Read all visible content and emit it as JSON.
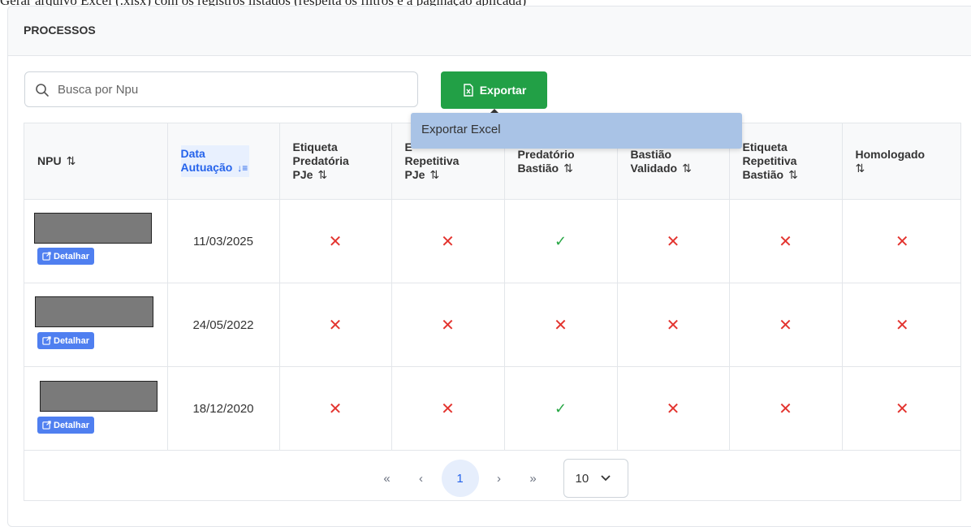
{
  "top_text": "Gerar arquivo Excel (.xlsx) com os registros listados (respeita os filtros e a paginação aplicada)",
  "panel": {
    "title": "PROCESSOS"
  },
  "search": {
    "placeholder": "Busca por Npu",
    "value": ""
  },
  "export": {
    "label": "Exportar",
    "menu": {
      "item_excel": "Exportar Excel"
    }
  },
  "table": {
    "columns": [
      {
        "label": "NPU",
        "sort": "⇅"
      },
      {
        "label": "Data Autuação",
        "sort": "↓≡",
        "sorted": true
      },
      {
        "label": "Etiqueta Predatória PJe",
        "sort": "⇅"
      },
      {
        "label": "Etiqueta Repetitiva PJe",
        "sort": "⇅"
      },
      {
        "label": "Predatório Bastião",
        "sort": "⇅"
      },
      {
        "label": "Bastião Validado",
        "sort": "⇅"
      },
      {
        "label": "Etiqueta Repetitiva Bastião",
        "sort": "⇅"
      },
      {
        "label": "Homologado",
        "sort": "⇅"
      }
    ],
    "header_visible": {
      "npu": "NPU",
      "data_1": "Data",
      "data_2": "Autuação",
      "etiq_pred_1": "Etiqueta",
      "etiq_pred_2": "Predatória",
      "etiq_pred_3": "PJe",
      "etiq_rep_1": "E",
      "etiq_rep_2": "Repetitiva",
      "etiq_rep_3": "PJe",
      "pred_bastiao_1": "Predatório",
      "pred_bastiao_2": "Bastião",
      "bast_val_1": "Bastião",
      "bast_val_2": "Validado",
      "etiq_rep_bast_1": "Etiqueta",
      "etiq_rep_bast_2": "Repetitiva",
      "etiq_rep_bast_3": "Bastião",
      "homologado": "Homologado"
    },
    "detail_label": "Detalhar",
    "rows": [
      {
        "date": "11/03/2025",
        "flags": [
          false,
          false,
          true,
          false,
          false,
          false
        ]
      },
      {
        "date": "24/05/2022",
        "flags": [
          false,
          false,
          false,
          false,
          false,
          false
        ]
      },
      {
        "date": "18/12/2020",
        "flags": [
          false,
          false,
          true,
          false,
          false,
          false
        ]
      }
    ],
    "mark_true": "✓",
    "mark_false": "✕"
  },
  "pagination": {
    "first": "«",
    "prev": "‹",
    "current_page": "1",
    "next": "›",
    "last": "»",
    "rows_per_page": "10"
  },
  "colors": {
    "export_button": "#22a046",
    "accent_blue": "#2563eb",
    "detail_button": "#4f7ff0",
    "mark_false": "#e3342f",
    "mark_true": "#28a745",
    "dropdown_bg": "#a9c3e6"
  },
  "icons": {
    "search": "search-icon",
    "export": "excel-file-icon",
    "detail": "external-link-icon",
    "dropdown_arrow": "chevron-down-icon"
  }
}
